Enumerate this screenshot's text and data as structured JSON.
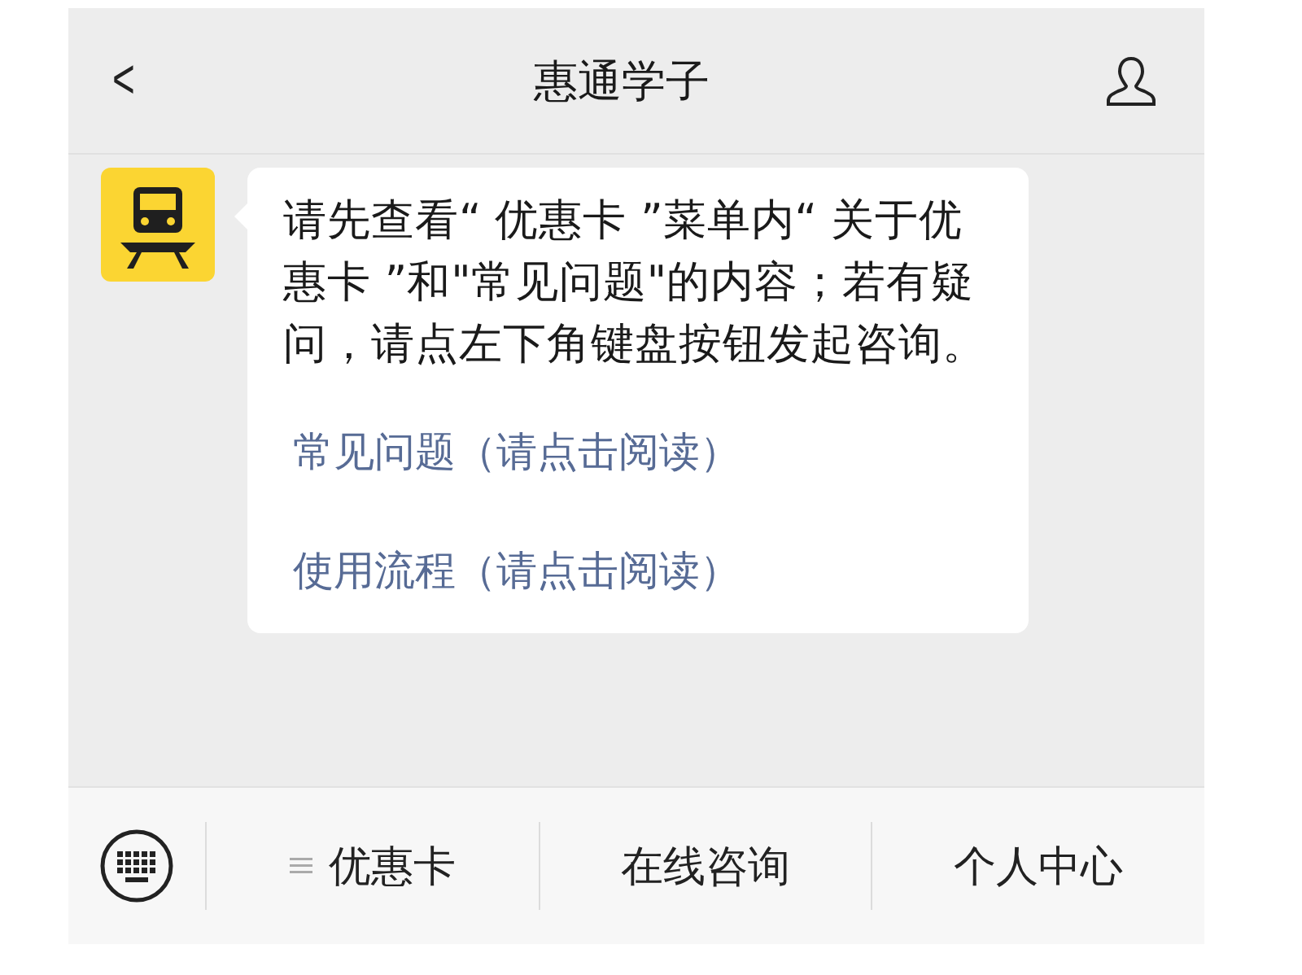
{
  "header": {
    "back": "<",
    "title": "惠通学子"
  },
  "message": {
    "text": "请先查看“ 优惠卡 ”菜单内“ 关于优惠卡 ”和\"常见问题\"的内容；若有疑问，请点左下角键盘按钮发起咨询。",
    "links": [
      "常见问题（请点击阅读）",
      "使用流程（请点击阅读）"
    ]
  },
  "menu": [
    {
      "kind": "submenu",
      "label": "优惠卡"
    },
    {
      "kind": "plain",
      "label": "在线咨询"
    },
    {
      "kind": "plain",
      "label": "个人中心"
    }
  ]
}
